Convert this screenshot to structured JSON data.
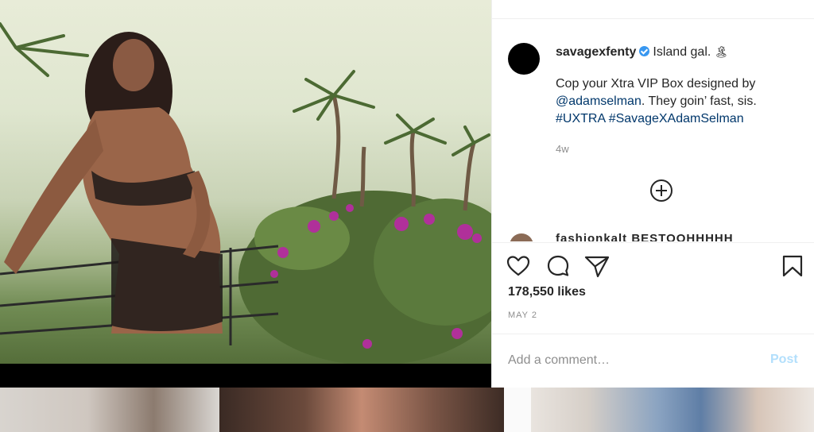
{
  "post": {
    "username": "savagexfenty",
    "caption_intro": "Island gal.",
    "island_emoji": "🏝",
    "caption_line1": "Cop your Xtra VIP Box designed by",
    "mention": "@adamselman",
    "caption_line2_rest": ". They goin’ fast, sis.",
    "hashtag1": "#UXTRA",
    "hashtag2": "#SavageXAdamSelman",
    "time_ago": "4w",
    "next_comment_partial": "fashionkalt BESTOOHHHHH",
    "likes": "178,550 likes",
    "date": "MAY 2",
    "comment_placeholder": "Add a comment…",
    "post_label": "Post"
  },
  "colors": {
    "link": "#00376b",
    "verified": "#3897f0",
    "post_button_disabled": "#b2dffc"
  },
  "icons": [
    "verified-badge-icon",
    "add-circle-icon",
    "heart-icon",
    "comment-bubble-icon",
    "share-paper-plane-icon",
    "bookmark-icon"
  ]
}
